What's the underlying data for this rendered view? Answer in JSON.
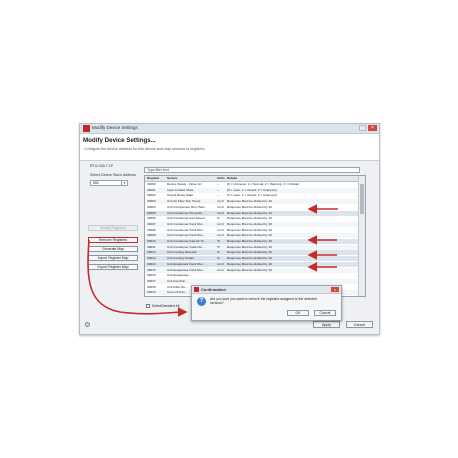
{
  "window": {
    "title": "Modify Device Settings",
    "header_title": "Modify Device Settings...",
    "header_subtitle": "Configure the device address for this device and map sensors to registers."
  },
  "device": {
    "list_label": "RTU-03A 7.1P",
    "address_label": "Select Device Slave Address",
    "address_value": "001"
  },
  "filter": {
    "placeholder": "Type filter text"
  },
  "table": {
    "columns": [
      "Register",
      "Sensor",
      "Units",
      "Details"
    ],
    "rows": [
      [
        "30000",
        "Device Status - Intrue 1C",
        "--",
        "(0 = Unknown, 1 = Normal, 2 = Warning, 3 = Critical)"
      ],
      [
        "30001",
        "Input Contact State",
        "--",
        "(0 = open, 1 = closed, 2 = Unknown)"
      ],
      [
        "30002",
        "Output Relay State",
        "--",
        "(0 = open, 1 = closed, 2 = Unknown)"
      ],
      [
        "30003",
        "Unit Air Filter Run Hours",
        "run h",
        "Response Must be divided by 10"
      ],
      [
        "30004",
        "Unit Compressor Run Hours",
        "run h",
        "Response Must be divided by 10"
      ],
      [
        "30005",
        "Unit Condenser Pump Ru...",
        "run h",
        "Response Must be divided by 10"
      ],
      [
        "30006",
        "Unit Condenser Fan Speed",
        "%",
        "Response Must be divided by 10"
      ],
      [
        "30007",
        "Unit Condenser Fan1 Run ...",
        "run h",
        "Response Must be divided by 10"
      ],
      [
        "30008",
        "Unit Condenser Fan2 Run ...",
        "run h",
        "Response Must be divided by 10"
      ],
      [
        "30009",
        "Unit Condenser Fan3 Run ...",
        "run h",
        "Response Must be divided by 10"
      ],
      [
        "30010",
        "Unit Condenser Inlet Air Te...",
        "°F",
        "Response Must be divided by 10"
      ],
      [
        "30011",
        "Unit Condenser Outlet Air ...",
        "°F",
        "Response Must be divided by 10"
      ],
      [
        "30012",
        "Unit Cooling Demand",
        "%",
        "Response Must be divided by 10"
      ],
      [
        "30013",
        "Unit Cooling Output",
        "%",
        "Response Must be divided by 10"
      ],
      [
        "30014",
        "Unit Evaporator Fan1 Run ...",
        "run h",
        "Response Must be divided by 10"
      ],
      [
        "30015",
        "Unit Evaporator Fan2 Run ...",
        "run h",
        "Response Must be divided by 10"
      ],
      [
        "30016",
        "Unit Evaporator...",
        "",
        ""
      ],
      [
        "30017",
        "Unit Fan Run...",
        "",
        ""
      ],
      [
        "30018",
        "Unit Filter Ru...",
        "",
        ""
      ],
      [
        "30019",
        "Unit Left Fan...",
        "",
        ""
      ]
    ]
  },
  "sidebar": {
    "modify": "Modify Registers",
    "remove": "Remove Registers",
    "generate": "Generate Map",
    "import": "Import Register Map",
    "export": "Export Register Map"
  },
  "checkbox_label": "Select/Deselect All",
  "buttons": {
    "apply": "Apply",
    "cancel": "Cancel"
  },
  "dialog": {
    "title": "Confirmation",
    "message": "Are you sure you want to remove the registers assigned to the selected sensors?",
    "ok": "OK",
    "cancel": "Cancel"
  },
  "colors": {
    "annotation": "#c62b2b",
    "accent": "#c2272d"
  }
}
